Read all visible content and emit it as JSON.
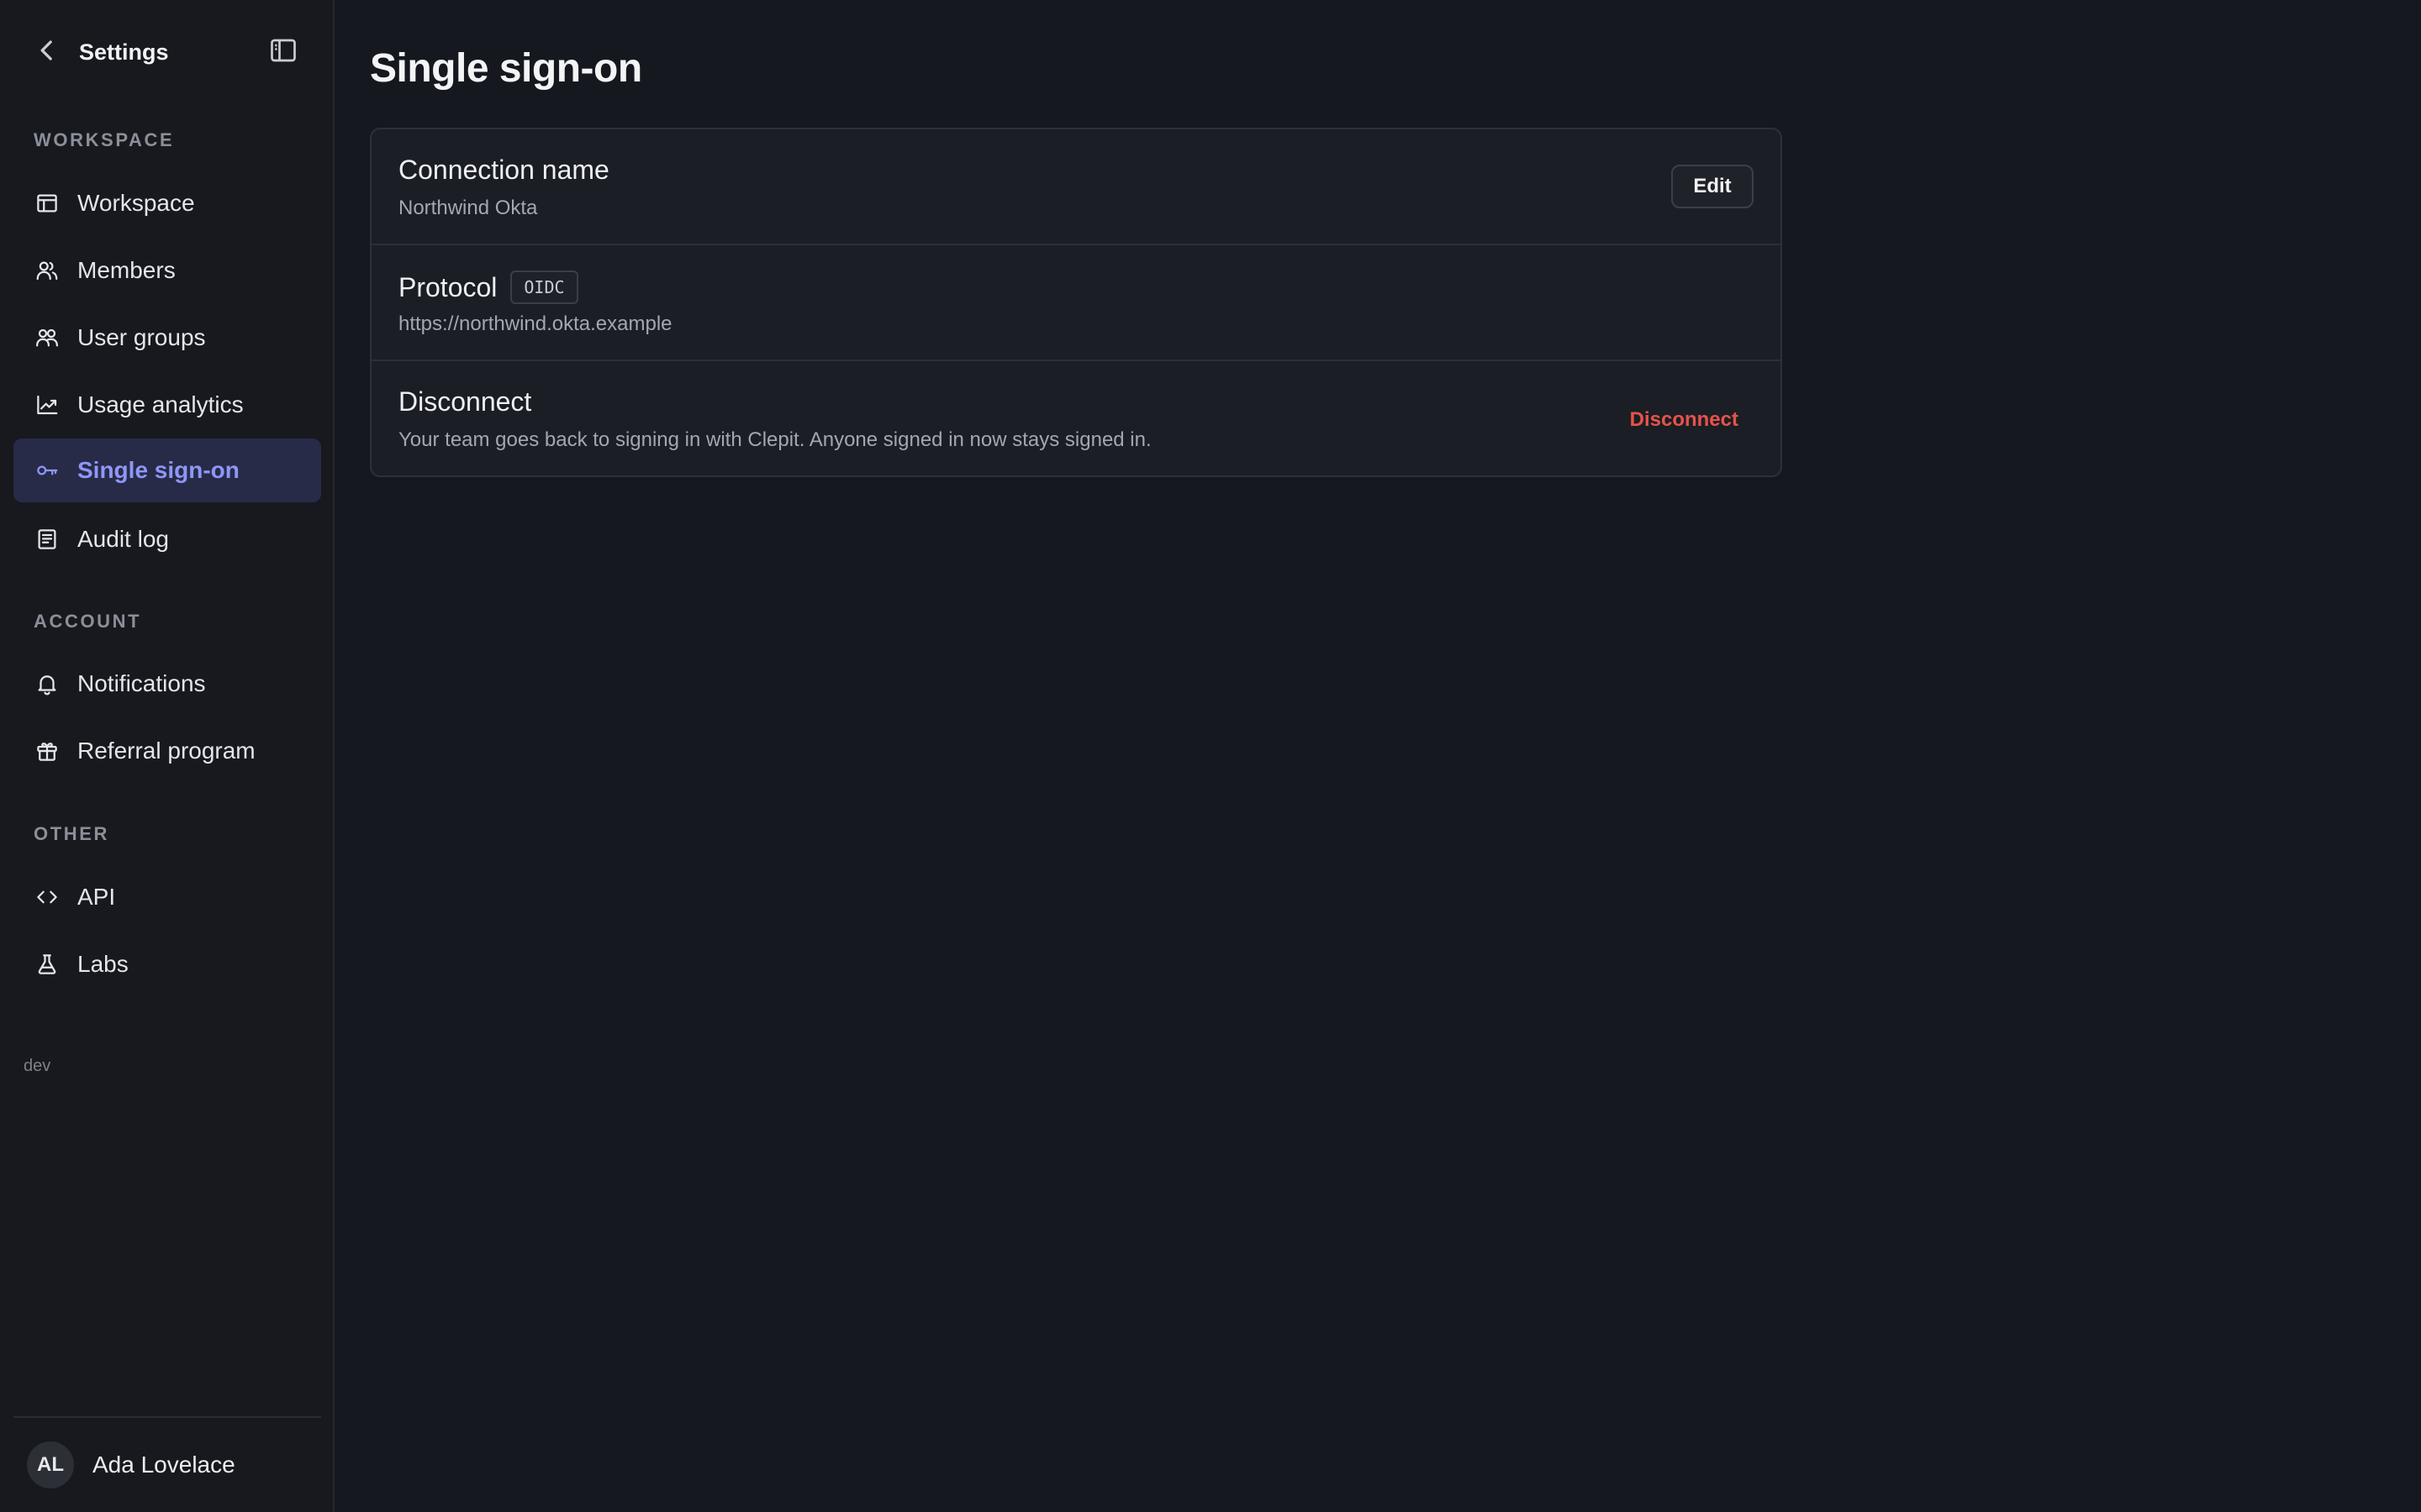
{
  "sidebar": {
    "title": "Settings",
    "sections": [
      {
        "label": "Workspace",
        "items": [
          {
            "label": "Workspace",
            "icon": "layout-icon"
          },
          {
            "label": "Members",
            "icon": "users-icon"
          },
          {
            "label": "User groups",
            "icon": "user-groups-icon"
          },
          {
            "label": "Usage analytics",
            "icon": "trend-icon"
          },
          {
            "label": "Single sign-on",
            "icon": "key-icon",
            "active": true
          },
          {
            "label": "Audit log",
            "icon": "document-icon"
          }
        ]
      },
      {
        "label": "Account",
        "items": [
          {
            "label": "Notifications",
            "icon": "bell-icon"
          },
          {
            "label": "Referral program",
            "icon": "gift-icon"
          }
        ]
      },
      {
        "label": "Other",
        "items": [
          {
            "label": "API",
            "icon": "code-icon"
          },
          {
            "label": "Labs",
            "icon": "flask-icon"
          }
        ]
      }
    ],
    "env": "dev",
    "user": {
      "initials": "AL",
      "name": "Ada Lovelace"
    }
  },
  "main": {
    "title": "Single sign-on",
    "rows": [
      {
        "title": "Connection name",
        "value": "Northwind Okta",
        "action": "Edit"
      },
      {
        "title": "Protocol",
        "badge": "OIDC",
        "value": "https://northwind.okta.example"
      },
      {
        "title": "Disconnect",
        "value": "Your team goes back to signing in with Clepit. Anyone signed in now stays signed in.",
        "action": "Disconnect"
      }
    ]
  },
  "colors": {
    "accent": "#8f96f7",
    "active_bg": "#272b47",
    "danger": "#e5534b",
    "background": "#15181e"
  }
}
